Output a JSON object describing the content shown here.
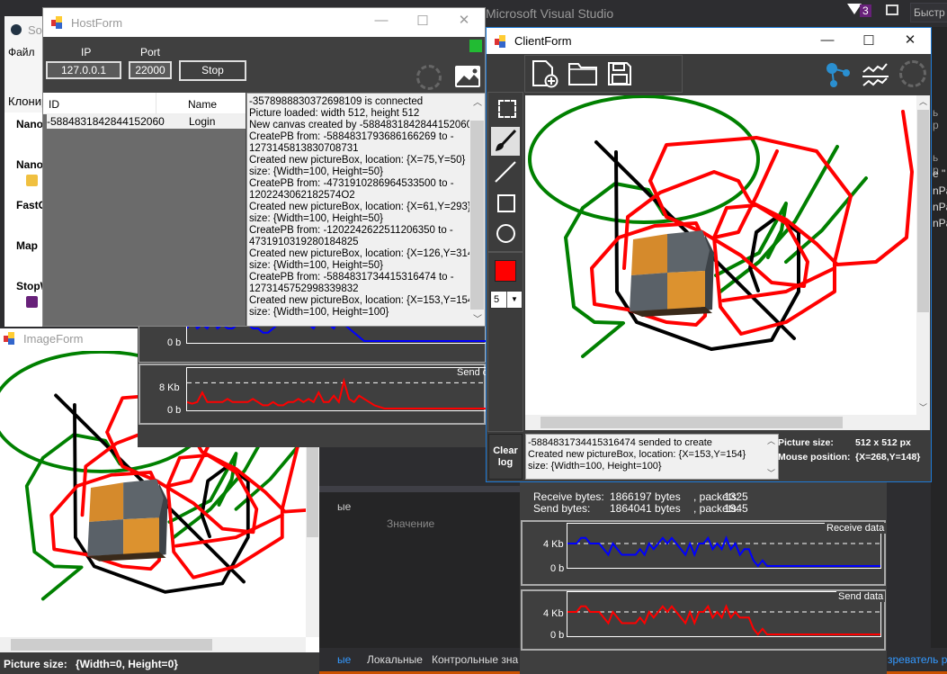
{
  "vs": {
    "title": "Microsoft Visual Studio",
    "notif_count": "3",
    "quick_launch": "Быстр",
    "left_panel": {
      "title": "Sou",
      "menu_file": "Файл",
      "clone": "Клонир",
      "items": [
        "Nano",
        "Nano",
        "FastC",
        "Map",
        "StopW"
      ]
    },
    "bottom": {
      "tab_partial": "ые",
      "column_value": "Значение",
      "tabs": [
        "ые",
        "Локальные",
        "Контрольные зна"
      ],
      "right_tab": "зреватель р"
    },
    "right_partial": [
      "ь р",
      "ь р",
      "е \"",
      "nPa",
      "nPa",
      "nPa"
    ]
  },
  "host": {
    "title": "HostForm",
    "ip_label": "IP",
    "port_label": "Port",
    "ip": "127.0.0.1",
    "port": "22000",
    "stop": "Stop",
    "status_color": "#22bb33",
    "list": {
      "headers": [
        "ID",
        "Name"
      ],
      "rows": [
        {
          "id": "-5884831842844152060",
          "name": "Login"
        }
      ]
    },
    "log": [
      "-3578988830372698109 is connected",
      "Picture loaded: width 512, height 512",
      "New canvas created by -5884831842844152060",
      "CreatePB from: -5884831793686166269 to -",
      "1273145813830708731",
      "Created new pictureBox, location: {X=75,Y=50}",
      "size: {Width=100, Height=50}",
      "CreatePB from: -4731910286964533500 to -",
      "1202243062182574O2",
      "Created new pictureBox, location: {X=61,Y=293}",
      "size: {Width=100, Height=50}",
      "CreatePB from: -1202242622511206350 to -",
      "4731910319280184825",
      "Created new pictureBox, location: {X=126,Y=314}",
      "size: {Width=100, Height=50}",
      "CreatePB from: -5884831734415316474 to -",
      "1273145752998339832",
      "Created new pictureBox, location: {X=153,Y=154}",
      "size: {Width=100, Height=100}"
    ],
    "stats": {
      "receive": {
        "zero": "0 b"
      },
      "send": {
        "title": "Send d",
        "mid": "8 Kb",
        "zero": "0 b"
      }
    }
  },
  "client": {
    "title": "ClientForm",
    "brush_size": "5",
    "current_color": "#ff0000",
    "clear_log": [
      "Clear",
      "log"
    ],
    "log": [
      "-5884831734415316474 sended to create",
      "Created new pictureBox, location: {X=153,Y=154}",
      "size: {Width=100, Height=100}"
    ],
    "picture_size_label": "Picture size:",
    "picture_size": "512 x 512 px",
    "mouse_label": "Mouse position:",
    "mouse_pos": "{X=268,Y=148}",
    "stats": {
      "receive_label": "Receive bytes:",
      "receive_bytes": "1866197 bytes",
      "packets_label": ", packets:",
      "receive_packets": "1325",
      "send_label": "Send bytes:",
      "send_bytes": "1864041 bytes",
      "send_packets": "1945",
      "receive_chart": {
        "title": "Receive data",
        "mid": "4 Kb",
        "zero": "0 b"
      },
      "send_chart": {
        "title": "Send data",
        "mid": "4 Kb",
        "zero": "0 b"
      }
    }
  },
  "image_form": {
    "title": "ImageForm",
    "status_label": "Picture size:",
    "status_value": "{Width=0, Height=0}"
  },
  "chart_data": [
    {
      "type": "line",
      "title": "Receive data",
      "ylabel": "bytes",
      "ylim": [
        0,
        7.2
      ],
      "unit": "Kb",
      "color": "#0000ff",
      "values": [
        4,
        4,
        4,
        5,
        5,
        4,
        4,
        4,
        3,
        2,
        4,
        3,
        2,
        2,
        2,
        2,
        3,
        2,
        4,
        3,
        4,
        5,
        4,
        5,
        4,
        3,
        2,
        4,
        2,
        4,
        4,
        5,
        3,
        4,
        3,
        5,
        3,
        4,
        2,
        3,
        3,
        1,
        0,
        1,
        0,
        0,
        0,
        0,
        0,
        0,
        0,
        0,
        0,
        0,
        0,
        0,
        0,
        0,
        0,
        0,
        0,
        0,
        0,
        0,
        0,
        0,
        0,
        0,
        0,
        0
      ]
    },
    {
      "type": "line",
      "title": "Send data",
      "ylabel": "bytes",
      "ylim": [
        0,
        7.2
      ],
      "unit": "Kb",
      "color": "#ff0000",
      "values": [
        4,
        4,
        4,
        5,
        5,
        4,
        4,
        4,
        3,
        2,
        4,
        3,
        2,
        2,
        2,
        2,
        3,
        2,
        4,
        3,
        4,
        5,
        4,
        5,
        4,
        3,
        2,
        4,
        2,
        4,
        4,
        5,
        3,
        4,
        3,
        5,
        3,
        4,
        3,
        3,
        3,
        1,
        0,
        1,
        0,
        0,
        0,
        0,
        0,
        0,
        0,
        0,
        0,
        0,
        0,
        0,
        0,
        0,
        0,
        0,
        0,
        0,
        0,
        0,
        0,
        0,
        0,
        0,
        0,
        0
      ]
    },
    {
      "type": "line",
      "title": "Send d",
      "ylabel": "bytes",
      "ylim": [
        0,
        12
      ],
      "unit": "Kb",
      "color": "#ff0000",
      "values": [
        2,
        1.5,
        2,
        5,
        2,
        2,
        2,
        2,
        3,
        2,
        2,
        2,
        2,
        3,
        2,
        1,
        1,
        2,
        1,
        1,
        2,
        2,
        3,
        2,
        3,
        2,
        5,
        2,
        2,
        4,
        2,
        8.5,
        3,
        2,
        4,
        3,
        2,
        1,
        0.5,
        0,
        0,
        0,
        0,
        0,
        0,
        0,
        0,
        0,
        0,
        0,
        0,
        0,
        0,
        0,
        0,
        0,
        0,
        0,
        0,
        0
      ]
    },
    {
      "type": "line",
      "title": "Receive (host)",
      "ylabel": "bytes",
      "ylim": [
        0,
        12
      ],
      "unit": "Kb",
      "color": "#0000ff",
      "values": [
        3,
        5,
        3,
        4,
        3,
        5,
        3,
        4,
        3,
        3,
        4,
        5,
        4,
        3,
        3,
        2,
        2,
        3,
        4,
        5,
        4,
        4,
        6,
        5,
        4,
        3,
        5,
        6,
        4,
        3,
        5,
        4,
        3,
        2,
        1,
        0,
        0,
        0,
        0,
        0,
        0,
        0,
        0,
        0,
        0,
        0,
        0,
        0,
        0,
        0,
        0,
        0,
        0,
        0,
        0,
        0,
        0,
        0,
        0,
        0
      ]
    }
  ]
}
